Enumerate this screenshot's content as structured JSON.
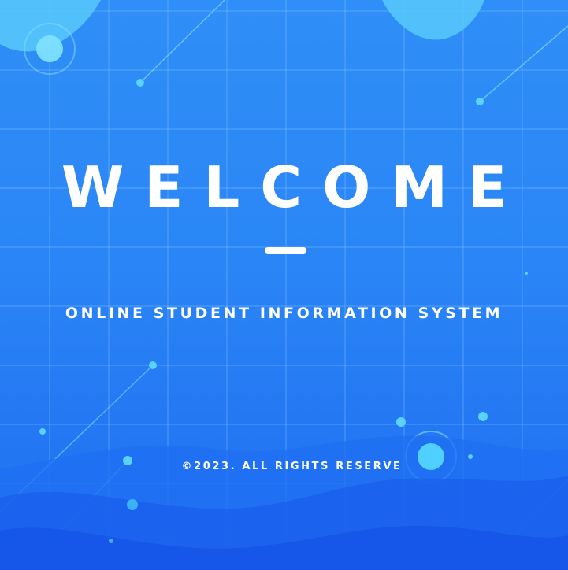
{
  "welcome": {
    "title": "WELCOME",
    "subtitle": "ONLINE STUDENT INFORMATION SYSTEM",
    "copyright": "©2023. ALL RIGHTS RESERVE"
  },
  "colors": {
    "background": "#2a86f6",
    "accent": "#5ad2ff",
    "text": "#ffffff"
  }
}
